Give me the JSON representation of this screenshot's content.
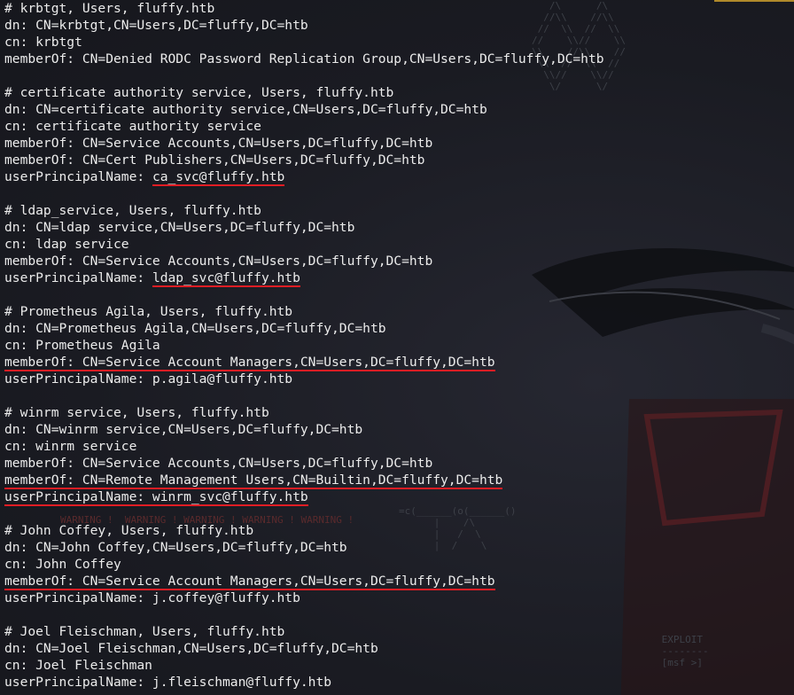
{
  "terminal": {
    "lines": [
      {
        "text": "# krbtgt, Users, fluffy.htb"
      },
      {
        "text": "dn: CN=krbtgt,CN=Users,DC=fluffy,DC=htb"
      },
      {
        "text": "cn: krbtgt"
      },
      {
        "text": "memberOf: CN=Denied RODC Password Replication Group,CN=Users,DC=fluffy,DC=htb"
      },
      {
        "text": ""
      },
      {
        "text": "# certificate authority service, Users, fluffy.htb"
      },
      {
        "text": "dn: CN=certificate authority service,CN=Users,DC=fluffy,DC=htb"
      },
      {
        "text": "cn: certificate authority service"
      },
      {
        "text": "memberOf: CN=Service Accounts,CN=Users,DC=fluffy,DC=htb"
      },
      {
        "text": "memberOf: CN=Cert Publishers,CN=Users,DC=fluffy,DC=htb"
      },
      {
        "text": "userPrincipalName: ",
        "highlight": "ca_svc@fluffy.htb"
      },
      {
        "text": ""
      },
      {
        "text": "# ldap_service, Users, fluffy.htb"
      },
      {
        "text": "dn: CN=ldap service,CN=Users,DC=fluffy,DC=htb"
      },
      {
        "text": "cn: ldap service"
      },
      {
        "text": "memberOf: CN=Service Accounts,CN=Users,DC=fluffy,DC=htb"
      },
      {
        "text": "userPrincipalName: ",
        "highlight": "ldap_svc@fluffy.htb"
      },
      {
        "text": ""
      },
      {
        "text": "# Prometheus Agila, Users, fluffy.htb"
      },
      {
        "text": "dn: CN=Prometheus Agila,CN=Users,DC=fluffy,DC=htb"
      },
      {
        "text": "cn: Prometheus Agila"
      },
      {
        "text": "",
        "highlight": "memberOf: CN=Service Account Managers,CN=Users,DC=fluffy,DC=htb"
      },
      {
        "text": "userPrincipalName: p.agila@fluffy.htb"
      },
      {
        "text": ""
      },
      {
        "text": "# winrm service, Users, fluffy.htb"
      },
      {
        "text": "dn: CN=winrm service,CN=Users,DC=fluffy,DC=htb"
      },
      {
        "text": "cn: winrm service"
      },
      {
        "text": "memberOf: CN=Service Accounts,CN=Users,DC=fluffy,DC=htb"
      },
      {
        "text": "",
        "highlight": "memberOf: CN=Remote Management Users,CN=Builtin,DC=fluffy,DC=htb"
      },
      {
        "text": "",
        "highlight": "userPrincipalName: winrm_svc@fluffy.htb"
      },
      {
        "text": ""
      },
      {
        "text": "# John Coffey, Users, fluffy.htb"
      },
      {
        "text": "dn: CN=John Coffey,CN=Users,DC=fluffy,DC=htb"
      },
      {
        "text": "cn: John Coffey"
      },
      {
        "text": "",
        "highlight": "memberOf: CN=Service Account Managers,CN=Users,DC=fluffy,DC=htb"
      },
      {
        "text": "userPrincipalName: j.coffey@fluffy.htb"
      },
      {
        "text": ""
      },
      {
        "text": "# Joel Fleischman, Users, fluffy.htb"
      },
      {
        "text": "dn: CN=Joel Fleischman,CN=Users,DC=fluffy,DC=htb"
      },
      {
        "text": "cn: Joel Fleischman"
      },
      {
        "text": "userPrincipalName: j.fleischman@fluffy.htb"
      }
    ]
  },
  "colors": {
    "text": "#ececec",
    "underline": "#e11d24",
    "background": "#1a1b22"
  }
}
